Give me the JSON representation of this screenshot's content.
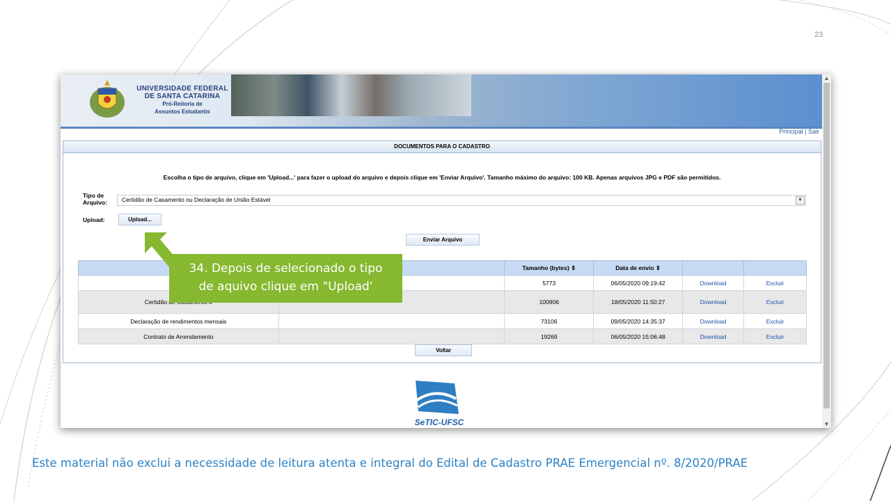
{
  "slide": {
    "number": "23",
    "footer": "Este material não exclui a necessidade de leitura atenta e integral do Edital de Cadastro PRAE Emergencial nº. 8/2020/PRAE"
  },
  "banner": {
    "university_line1": "UNIVERSIDADE FEDERAL",
    "university_line2": "DE SANTA CATARINA",
    "dept_line1": "Pró-Reitoria de",
    "dept_line2": "Assuntos Estudantis"
  },
  "toplinks": {
    "principal": "Principal",
    "separator": "|",
    "sair": "Sair"
  },
  "panel": {
    "title": "DOCUMENTOS PARA O CADASTRO",
    "instructions": "Escolha o tipo de arquivo, clique em 'Upload...' para fazer o upload do arquivo e depois clique em 'Enviar Arquivo'. Tamanho máximo do arquivo: 100 KB. Apenas arquivos JPG e PDF são permitidos.",
    "tipo_label_1": "Tipo de",
    "tipo_label_2": "Arquivo:",
    "tipo_selected": "Certidão de Casamento ou Declaração de União Estável",
    "upload_label": "Upload:",
    "upload_button": "Upload...",
    "send_button": "Enviar Arquivo",
    "back_button": "Voltar"
  },
  "table": {
    "headers": [
      "",
      "",
      "Tamanho (bytes) ⇕",
      "Data de envio ⇕",
      "",
      ""
    ],
    "rows": [
      {
        "tipo": "C",
        "tamanho": "5773",
        "data": "06/05/2020 09:19:42",
        "download": "Download",
        "excluir": "Excluir"
      },
      {
        "tipo": "Certidão de Casamento o",
        "tamanho": "100906",
        "data": "18/05/2020 11:50:27",
        "download": "Download",
        "excluir": "Excluir"
      },
      {
        "tipo": "Declaração de rendimentos mensais",
        "tamanho": "73106",
        "data": "09/05/2020 14:35:37",
        "download": "Download",
        "excluir": "Excluir"
      },
      {
        "tipo": "Contrato de Arrendamento",
        "tamanho": "19269",
        "data": "06/05/2020 15:06:48",
        "download": "Download",
        "excluir": "Excluir"
      }
    ]
  },
  "callout": {
    "line1": "34. Depois de selecionado o tipo",
    "line2": "de aquivo clique em \"Upload'"
  },
  "setic": {
    "label": "SeTIC-UFSC"
  },
  "colors": {
    "accent_green": "#86b830",
    "footer_blue": "#2e83c6",
    "link_blue": "#1f4fa8",
    "header_blue": "#c7daf4"
  }
}
